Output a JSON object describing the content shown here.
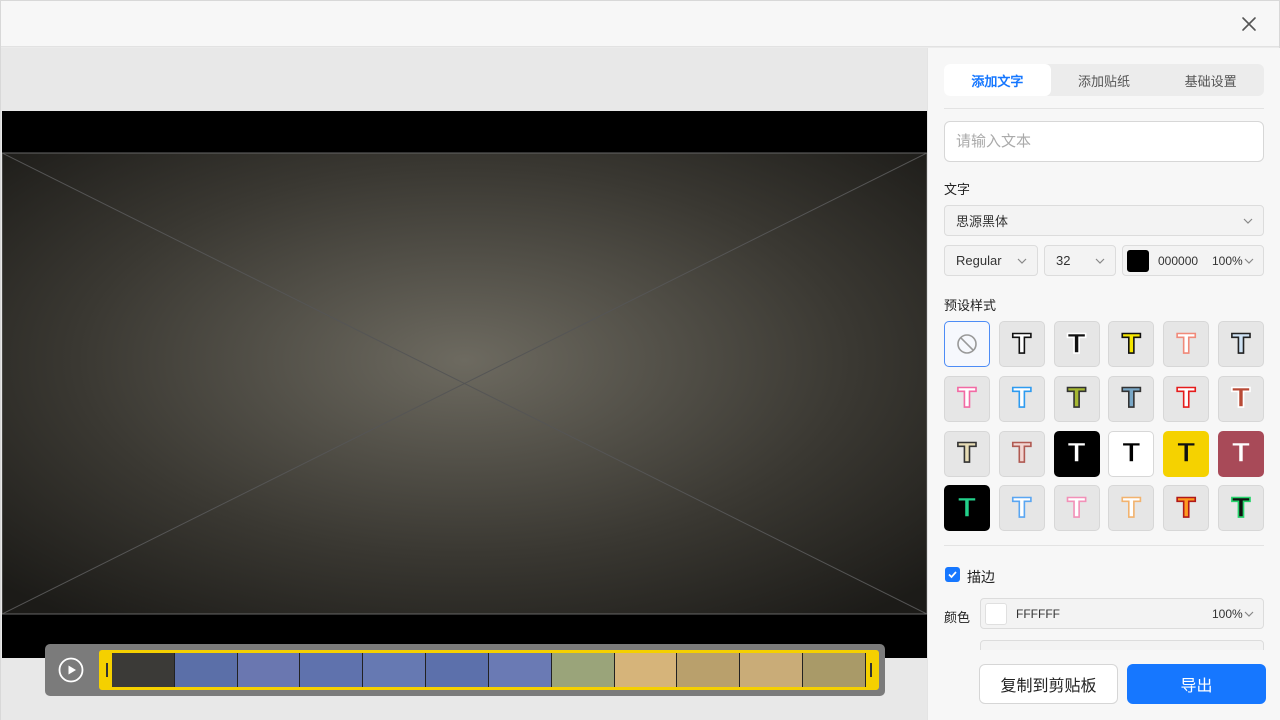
{
  "window": {
    "close_icon": "close-icon"
  },
  "tabs": [
    {
      "label": "添加文字",
      "active": true
    },
    {
      "label": "添加贴纸",
      "active": false
    },
    {
      "label": "基础设置",
      "active": false
    }
  ],
  "text_input": {
    "placeholder": "请输入文本",
    "value": ""
  },
  "font_section": {
    "label": "文字",
    "font_family": "思源黑体",
    "weight": "Regular",
    "size": "32",
    "color_hex": "000000",
    "color": "#000000",
    "opacity": "100%"
  },
  "presets": {
    "label": "预设样式",
    "items": [
      {
        "name": "none"
      },
      {
        "fill": "#ffffff",
        "stroke": "#111111"
      },
      {
        "fill": "#111111",
        "stroke": "#ffffff"
      },
      {
        "fill": "#f5e600",
        "stroke": "#111111"
      },
      {
        "fill": "#ffffff",
        "stroke": "#f08a7a"
      },
      {
        "fill": "#cfe3f5",
        "stroke": "#222222"
      },
      {
        "fill": "#ffffff",
        "stroke": "#f26aa4"
      },
      {
        "fill": "#ffffff",
        "stroke": "#2e9bf0"
      },
      {
        "fill": "#a6b832",
        "stroke": "#333333"
      },
      {
        "fill": "#79a7c6",
        "stroke": "#333333"
      },
      {
        "fill": "#ffffff",
        "stroke": "#e51c1c"
      },
      {
        "fill": "#b84a36",
        "stroke": "#ffffff"
      },
      {
        "fill": "#e7dcb5",
        "stroke": "#333333"
      },
      {
        "fill": "#f2d6d2",
        "stroke": "#b05a52"
      },
      {
        "fill": "#ffffff",
        "stroke": "#000000",
        "bg": "#000000"
      },
      {
        "fill": "#000000",
        "stroke": "#ffffff",
        "bg": "#ffffff"
      },
      {
        "fill": "#111111",
        "stroke": "#f5d200",
        "bg": "#f5d200"
      },
      {
        "fill": "#ffffff",
        "stroke": "#a84a58",
        "bg": "#a84a58"
      },
      {
        "fill": "#23d18b",
        "stroke": "#000000",
        "bg": "#000000"
      },
      {
        "fill": "#ffffff",
        "stroke": "#5aa6f2"
      },
      {
        "fill": "#ffffff",
        "stroke": "#f291b8"
      },
      {
        "fill": "#ffffff",
        "stroke": "#f2b36f"
      },
      {
        "fill": "#ff9a1f",
        "stroke": "#b01818"
      },
      {
        "fill": "#111111",
        "stroke": "#26d46b"
      }
    ]
  },
  "stroke_section": {
    "checkbox_label": "描边",
    "checked": true,
    "color_label": "颜色",
    "color_hex": "FFFFFF",
    "color": "#ffffff",
    "opacity": "100%"
  },
  "footer": {
    "copy_label": "复制到剪贴板",
    "export_label": "导出"
  },
  "timeline": {
    "play_icon": "play-icon",
    "frame_count": 12
  }
}
